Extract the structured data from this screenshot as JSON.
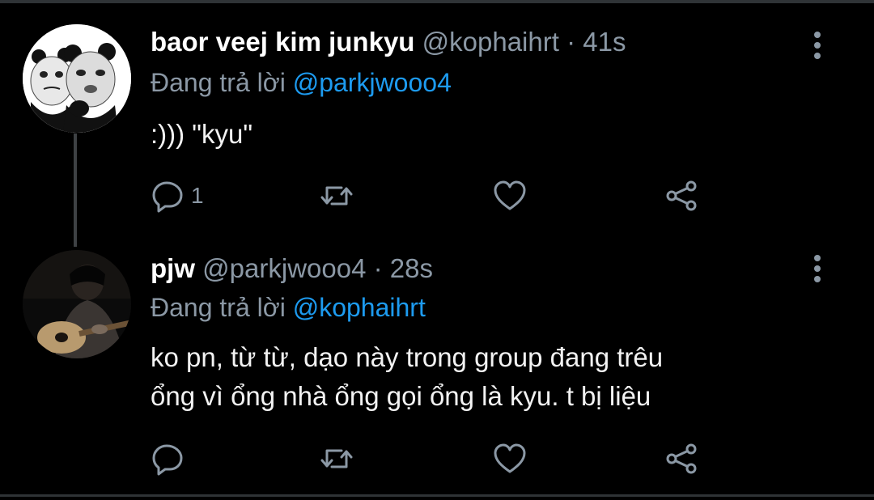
{
  "tweets": [
    {
      "name": "baor veej kim junkyu",
      "handle": "@kophaihrt",
      "separator": "·",
      "time": "41s",
      "replying_prefix": "Đang trả lời ",
      "replying_to": "@parkjwooo4",
      "text_lines": [
        ":))) \"kyu\""
      ],
      "reply_count": "1",
      "avatar_icon": "panda-meme-avatar"
    },
    {
      "name": "pjw",
      "handle": "@parkjwooo4",
      "separator": "·",
      "time": "28s",
      "replying_prefix": "Đang trả lời ",
      "replying_to": "@kophaihrt",
      "text_lines": [
        "ko pn, từ từ, dạo này trong group đang trêu",
        "ổng vì ổng nhà ổng gọi ổng là kyu. t bị liệu"
      ],
      "reply_count": "",
      "avatar_icon": "guitar-player-photo-avatar"
    }
  ],
  "colors": {
    "background": "#000000",
    "secondary_text": "#8b98a5",
    "accent": "#1d9bf0",
    "divider": "#2f3336"
  },
  "icons": [
    "reply-icon",
    "retweet-icon",
    "like-icon",
    "share-icon",
    "more-options-icon"
  ]
}
